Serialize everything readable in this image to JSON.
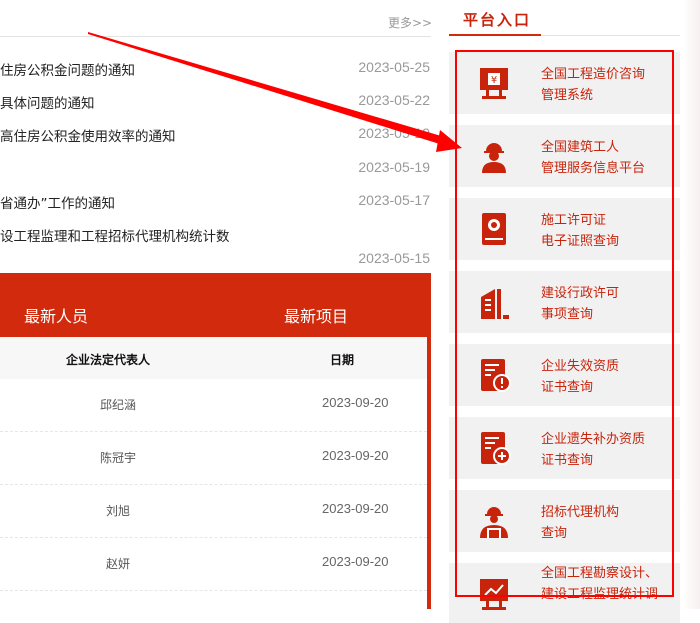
{
  "news": {
    "more_label": "更多>>",
    "items": [
      {
        "title": "住房公积金问题的通知",
        "date": "2023-05-25"
      },
      {
        "title": "具体问题的通知",
        "date": "2023-05-22"
      },
      {
        "title": "高住房公积金使用效率的通知",
        "date": "2023-05-19"
      },
      {
        "title": "",
        "date": "2023-05-19"
      },
      {
        "title": "省通办”工作的通知",
        "date": "2023-05-17"
      },
      {
        "title": "设工程监理和工程招标代理机构统计数",
        "date": "2023-05-15"
      }
    ]
  },
  "tabs": {
    "people": "最新人员",
    "projects": "最新项目"
  },
  "table": {
    "headers": [
      "企业法定代表人",
      "日期"
    ],
    "rows": [
      {
        "name": "邱纪涵",
        "date": "2023-09-20"
      },
      {
        "name": "陈冠宇",
        "date": "2023-09-20"
      },
      {
        "name": "刘旭",
        "date": "2023-09-20"
      },
      {
        "name": "赵妍",
        "date": "2023-09-20"
      }
    ]
  },
  "platform": {
    "title": "平台入口",
    "items": [
      {
        "l1": "全国工程造价咨询",
        "l2": "管理系统",
        "icon": "monitor-yen-icon"
      },
      {
        "l1": "全国建筑工人",
        "l2": "管理服务信息平台",
        "icon": "worker-icon"
      },
      {
        "l1": "施工许可证",
        "l2": "电子证照查询",
        "icon": "certificate-icon"
      },
      {
        "l1": "建设行政许可",
        "l2": "事项查询",
        "icon": "building-icon"
      },
      {
        "l1": "企业失效资质",
        "l2": "证书查询",
        "icon": "document-alert-icon"
      },
      {
        "l1": "企业遗失补办资质",
        "l2": "证书查询",
        "icon": "document-add-icon"
      },
      {
        "l1": "招标代理机构",
        "l2": "查询",
        "icon": "engineer-icon"
      },
      {
        "l1": "全国工程勘察设计、",
        "l2": "建设工程监理统计调",
        "icon": "monitor-chart-icon"
      }
    ]
  },
  "colors": {
    "accent": "#d22a0c",
    "highlight": "#ff0000"
  }
}
